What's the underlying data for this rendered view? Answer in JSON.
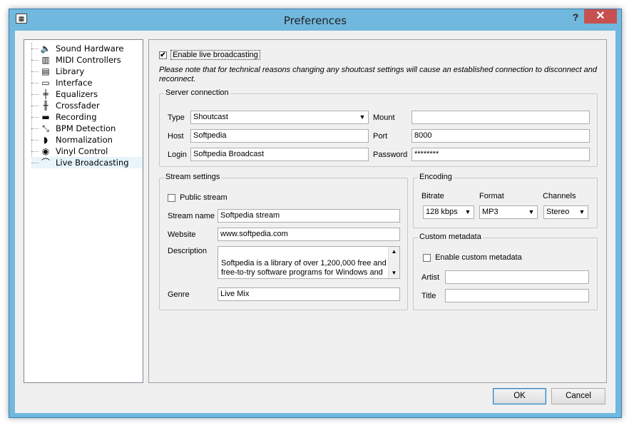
{
  "window": {
    "title": "Preferences",
    "help": "?",
    "close": "✕"
  },
  "tree": [
    {
      "label": "Sound Hardware",
      "icon": "speaker-icon",
      "glyph": "🔈"
    },
    {
      "label": "MIDI Controllers",
      "icon": "midi-keyboard-icon",
      "glyph": "▥"
    },
    {
      "label": "Library",
      "icon": "library-icon",
      "glyph": "▤"
    },
    {
      "label": "Interface",
      "icon": "monitor-icon",
      "glyph": "▭"
    },
    {
      "label": "Equalizers",
      "icon": "equalizer-icon",
      "glyph": "╪"
    },
    {
      "label": "Crossfader",
      "icon": "crossfader-icon",
      "glyph": "╫"
    },
    {
      "label": "Recording",
      "icon": "recording-icon",
      "glyph": "▬"
    },
    {
      "label": "BPM Detection",
      "icon": "bpm-icon",
      "glyph": "⤡"
    },
    {
      "label": "Normalization",
      "icon": "normalization-icon",
      "glyph": "◗"
    },
    {
      "label": "Vinyl Control",
      "icon": "vinyl-icon",
      "glyph": "◉"
    },
    {
      "label": "Live Broadcasting",
      "icon": "satellite-dish-icon",
      "glyph": "⌒"
    }
  ],
  "enable_live": {
    "label": "Enable live broadcasting",
    "checked": "✔"
  },
  "note": "Please note that for technical reasons changing any shoutcast settings will cause an established connection to disconnect and reconnect.",
  "server": {
    "title": "Server connection",
    "type_label": "Type",
    "type_value": "Shoutcast",
    "host_label": "Host",
    "host_value": "Softpedia",
    "login_label": "Login",
    "login_value": "Softpedia Broadcast",
    "mount_label": "Mount",
    "mount_value": "",
    "port_label": "Port",
    "port_value": "8000",
    "password_label": "Password",
    "password_value": "********"
  },
  "stream": {
    "title": "Stream settings",
    "public_label": "Public stream",
    "name_label": "Stream name",
    "name_value": "Softpedia stream",
    "website_label": "Website",
    "website_value": "www.softpedia.com",
    "description_label": "Description",
    "description_value": "Softpedia is a library of over 1,200,000 free and free-to-try software programs for Windows and Unix/Linux, games, Mac",
    "genre_label": "Genre",
    "genre_value": "Live Mix"
  },
  "encoding": {
    "title": "Encoding",
    "bitrate_label": "Bitrate",
    "bitrate_value": "128 kbps",
    "format_label": "Format",
    "format_value": "MP3",
    "channels_label": "Channels",
    "channels_value": "Stereo"
  },
  "metadata": {
    "title": "Custom metadata",
    "enable_label": "Enable custom metadata",
    "artist_label": "Artist",
    "artist_value": "",
    "title_label": "Title",
    "title_value": ""
  },
  "buttons": {
    "ok": "OK",
    "cancel": "Cancel"
  }
}
